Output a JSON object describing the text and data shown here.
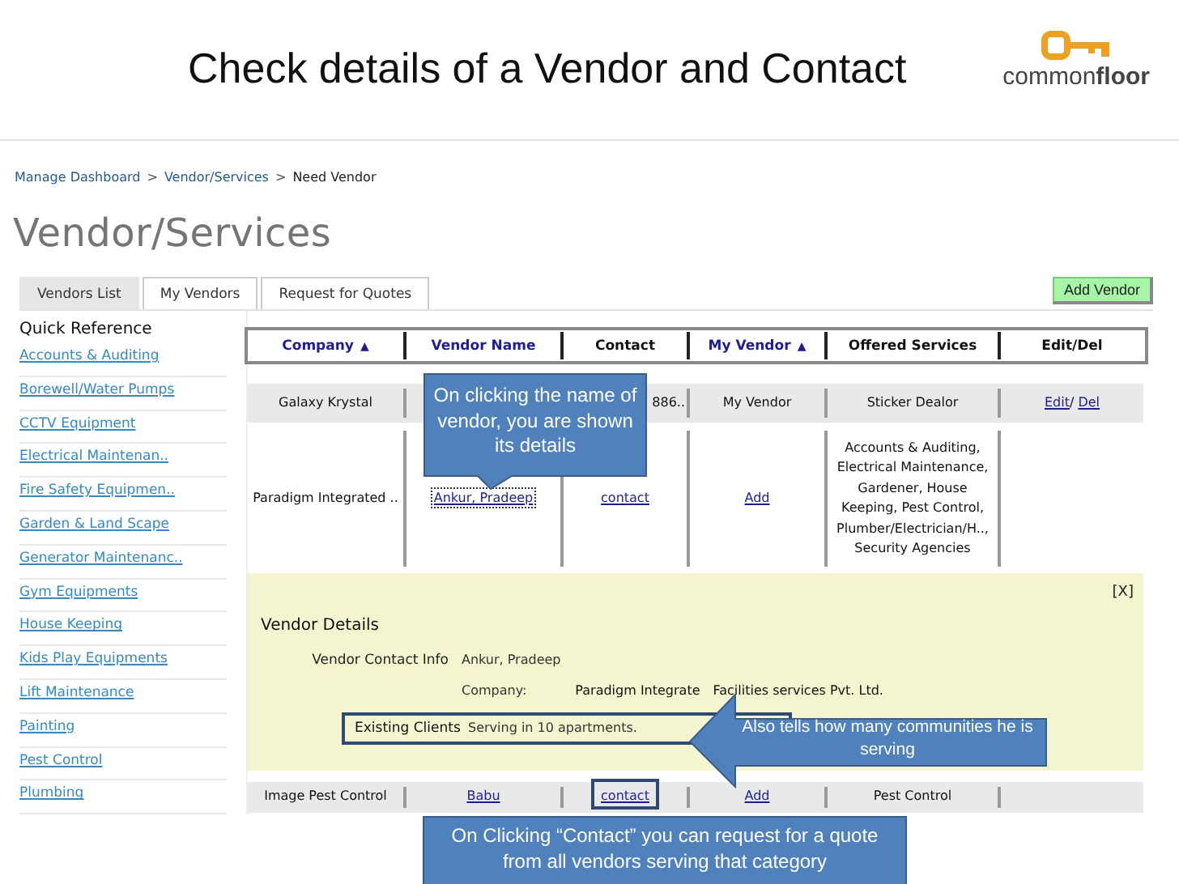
{
  "slide": {
    "title": "Check details of a Vendor and Contact",
    "logo": "common**floor**"
  },
  "breadcrumb": {
    "separator": ">",
    "items": [
      {
        "label": "Manage Dashboard",
        "link": true
      },
      {
        "label": "Vendor/Services",
        "link": true
      },
      {
        "label": "Need Vendor",
        "link": false
      }
    ]
  },
  "page_title": "Vendor/Services",
  "tabs": [
    {
      "label": "Vendors List",
      "selected": true
    },
    {
      "label": "My Vendors",
      "selected": false
    },
    {
      "label": "Request for Quotes",
      "selected": false
    }
  ],
  "add_vendor_button": "Add Vendor",
  "quick_reference": {
    "title": "Quick Reference",
    "items": [
      "Accounts & Auditing",
      "Borewell/Water Pumps",
      "CCTV Equipment",
      "Electrical Maintenan..",
      "Fire Safety Equipmen..",
      "Garden & Land Scape",
      "Generator Maintenanc..",
      "Gym Equipments",
      "House Keeping",
      "Kids Play Equipments",
      "Lift Maintenance",
      "Painting",
      "Pest Control",
      "Plumbing"
    ]
  },
  "table": {
    "columns": [
      {
        "label": "Company",
        "link": true,
        "sort": "▲"
      },
      {
        "label": "Vendor Name",
        "link": true
      },
      {
        "label": "Contact",
        "link": false
      },
      {
        "label": "My Vendor",
        "link": true,
        "sort": "▲"
      },
      {
        "label": "Offered Services",
        "link": false
      },
      {
        "label": "Edit/Del",
        "link": false
      }
    ],
    "rows": [
      {
        "shaded": true,
        "cells": [
          [
            {
              "text": "Galaxy Krystal",
              "link": false
            }
          ],
          [],
          [
            {
              "text": "886..",
              "link": false,
              "cut_left": true
            }
          ],
          [
            {
              "text": "My Vendor",
              "link": false
            }
          ],
          [
            {
              "text": "Sticker Dealor",
              "link": false
            }
          ],
          [
            {
              "text": "Edit",
              "link": true
            },
            {
              "text": "/ ",
              "link": false
            },
            {
              "text": "Del",
              "link": true
            }
          ]
        ]
      },
      {
        "shaded": false,
        "cells": [
          [
            {
              "text": "Paradigm Integrated ..",
              "link": false
            }
          ],
          [
            {
              "text": "Ankur, Pradeep",
              "link": true,
              "focused": true
            }
          ],
          [
            {
              "text": "contact",
              "link": true
            }
          ],
          [
            {
              "text": "Add",
              "link": true
            }
          ],
          [
            {
              "text": "Accounts & Auditing, Electrical Maintenance, Gardener, House Keeping, Pest Control, Plumber/Electrician/H.., Security Agencies",
              "link": false
            }
          ],
          []
        ]
      },
      {
        "shaded": true,
        "details": true,
        "cells": [
          [
            {
              "text": "Image Pest Control",
              "link": false
            }
          ],
          [
            {
              "text": "Babu",
              "link": true
            }
          ],
          [
            {
              "text": "contact",
              "link": true,
              "highlighted": true
            }
          ],
          [
            {
              "text": "Add",
              "link": true
            }
          ],
          [
            {
              "text": "Pest Control",
              "link": false
            }
          ],
          []
        ]
      }
    ]
  },
  "vendor_details": {
    "close": "[X]",
    "title": "Vendor Details",
    "contact_label": "Vendor Contact Info",
    "contact_value": "Ankur, Pradeep",
    "company_label": "Company:",
    "company_value": [
      "Paradigm Integrate",
      "Facilities services Pvt. Ltd."
    ],
    "clients_label": "Existing Clients",
    "clients_value": "Serving in 10 apartments.",
    "clients_highlighted": true
  },
  "callouts": [
    {
      "kind": "down",
      "text": "On clicking the name of vendor, you are shown its details"
    },
    {
      "kind": "left",
      "text": "Also tells how many communities he is serving"
    },
    {
      "kind": "box",
      "text": "On Clicking “Contact” you can request for a quote from all vendors serving that category"
    }
  ]
}
